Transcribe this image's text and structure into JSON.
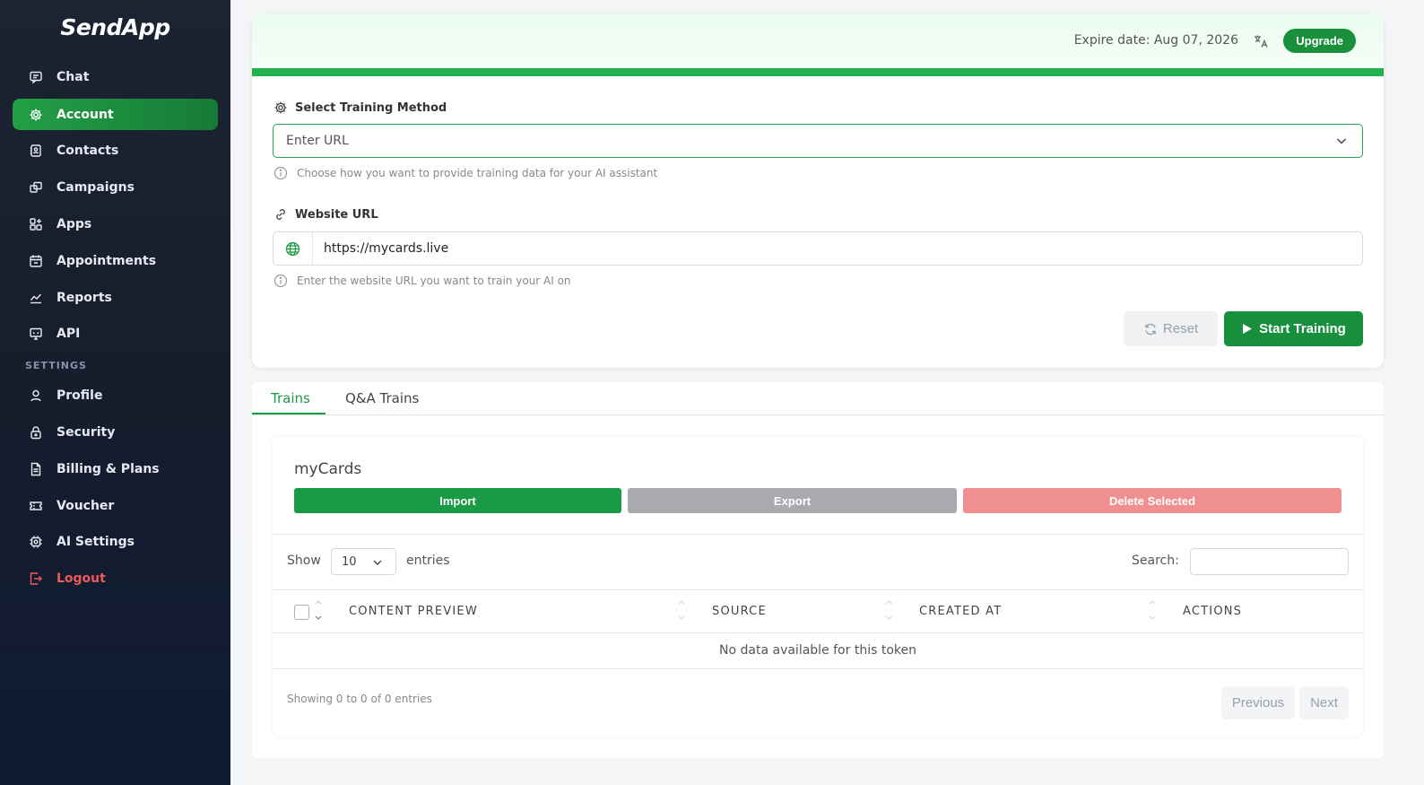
{
  "app": {
    "logo": "SendApp"
  },
  "sidebar": {
    "items": [
      {
        "label": "Chat",
        "icon": "chat-icon"
      },
      {
        "label": "Account",
        "icon": "gear-icon",
        "active": true
      },
      {
        "label": "Contacts",
        "icon": "contacts-icon"
      },
      {
        "label": "Campaigns",
        "icon": "campaigns-icon"
      },
      {
        "label": "Apps",
        "icon": "apps-icon"
      },
      {
        "label": "Appointments",
        "icon": "calendar-icon"
      },
      {
        "label": "Reports",
        "icon": "chart-icon"
      },
      {
        "label": "API",
        "icon": "monitor-icon"
      }
    ],
    "settings_label": "SETTINGS",
    "settings_items": [
      {
        "label": "Profile",
        "icon": "user-icon"
      },
      {
        "label": "Security",
        "icon": "lock-icon"
      },
      {
        "label": "Billing & Plans",
        "icon": "document-icon"
      },
      {
        "label": "Voucher",
        "icon": "ticket-icon"
      },
      {
        "label": "AI Settings",
        "icon": "ai-chip-icon"
      },
      {
        "label": "Logout",
        "icon": "logout-icon"
      }
    ]
  },
  "header": {
    "expire": "Expire date: Aug 07, 2026",
    "upgrade": "Upgrade"
  },
  "training": {
    "method_label": "Select Training Method",
    "method_value": "Enter URL",
    "method_help": "Choose how you want to provide training data for your AI assistant",
    "url_label": "Website URL",
    "url_value": "https://mycards.live",
    "url_help": "Enter the website URL you want to train your AI on",
    "reset": "Reset",
    "start": "Start Training"
  },
  "tabs": [
    {
      "label": "Trains",
      "active": true
    },
    {
      "label": "Q&A Trains"
    }
  ],
  "table": {
    "title": "myCards",
    "import": "Import",
    "export": "Export",
    "delete": "Delete Selected",
    "show_label": "Show",
    "show_value": "10",
    "entries_label": "entries",
    "search_label": "Search:",
    "columns": [
      "CONTENT PREVIEW",
      "SOURCE",
      "CREATED AT",
      "ACTIONS"
    ],
    "empty": "No data available for this token",
    "showing": "Showing 0 to 0 of 0 entries",
    "previous": "Previous",
    "next": "Next"
  },
  "colors": {
    "accent": "#1a9a45",
    "sidebar_bg": "#161d2c",
    "import": "#1a9a45",
    "export": "#a8aaad",
    "delete": "#f08f8f",
    "logout": "#ef5a5a"
  }
}
